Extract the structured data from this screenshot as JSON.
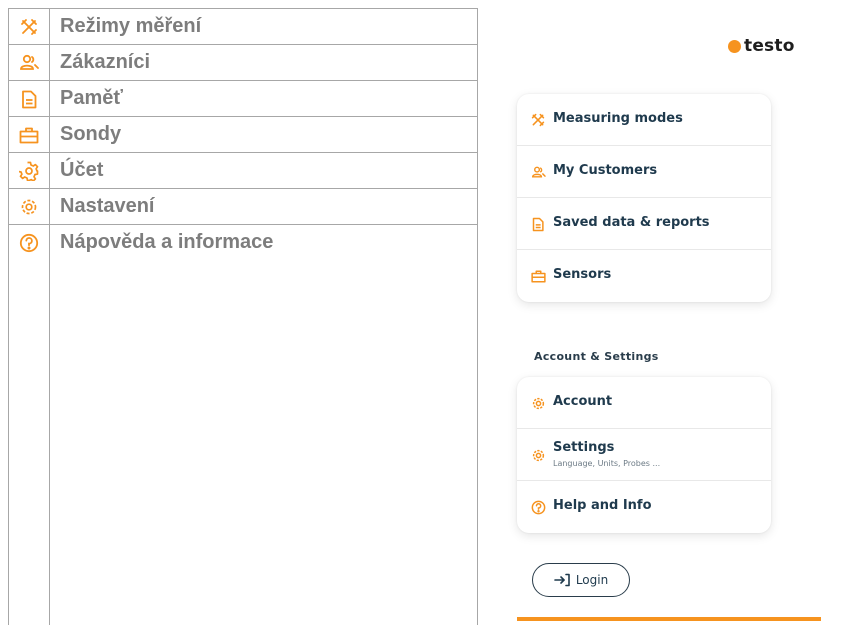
{
  "colors": {
    "accent": "#f6931f",
    "label_gray": "#7d7d7d",
    "app_text": "#1f3a4d"
  },
  "table": {
    "rows": [
      {
        "icon": "tools-icon",
        "label": "Režimy měření"
      },
      {
        "icon": "customers-icon",
        "label": "Zákazníci"
      },
      {
        "icon": "document-icon",
        "label": "Paměť"
      },
      {
        "icon": "toolbox-icon",
        "label": "Sondy"
      },
      {
        "icon": "gear-icon",
        "label": "Účet"
      },
      {
        "icon": "gear-icon",
        "label": "Nastavení"
      },
      {
        "icon": "help-icon",
        "label": "Nápověda a informace"
      }
    ]
  },
  "app": {
    "brand": "testo",
    "main_menu": [
      {
        "icon": "tools-icon",
        "label": "Measuring modes"
      },
      {
        "icon": "customers-icon",
        "label": "My Customers"
      },
      {
        "icon": "document-icon",
        "label": "Saved data & reports"
      },
      {
        "icon": "toolbox-icon",
        "label": "Sensors"
      }
    ],
    "section_title": "Account & Settings",
    "settings_menu": [
      {
        "icon": "gear-icon",
        "label": "Account"
      },
      {
        "icon": "gear-icon",
        "label": "Settings",
        "sublabel": "Language, Units, Probes ..."
      },
      {
        "icon": "help-icon",
        "label": "Help and Info"
      }
    ],
    "login_label": "Login"
  }
}
